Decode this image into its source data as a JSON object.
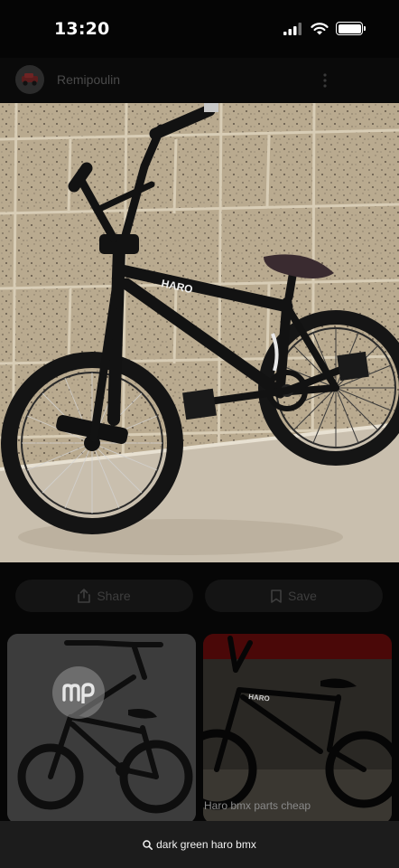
{
  "status_bar": {
    "time": "13:20",
    "signal_icon": "cellular-signal-icon",
    "wifi_icon": "wifi-icon",
    "battery_icon": "battery-icon"
  },
  "profile": {
    "username": "Remipoulin",
    "avatar_icon": "vehicle-avatar-icon",
    "menu_icon": "more-vertical-icon"
  },
  "main_image": {
    "subject": "black Haro BMX bike against concrete block wall",
    "frame_brand": "HARO"
  },
  "actions": {
    "share_label": "Share",
    "share_icon": "share-icon",
    "save_label": "Save",
    "save_icon": "bookmark-icon"
  },
  "related": [
    {
      "watermark_icon": "mp-logo-icon"
    },
    {
      "caption": "Haro bmx parts cheap"
    }
  ],
  "search": {
    "query": "dark green haro bmx",
    "icon": "search-icon"
  },
  "colors": {
    "background": "#000000",
    "bottom_bar": "#1c1c1c",
    "muted_text": "#3e3e3e"
  }
}
